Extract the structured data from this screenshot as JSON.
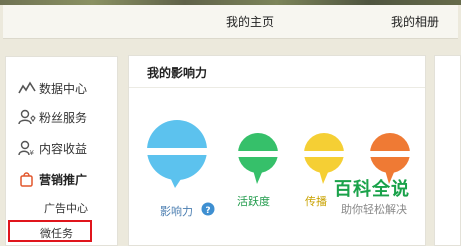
{
  "nav": {
    "tabs": [
      {
        "label": "我的主页"
      },
      {
        "label": "我的相册"
      }
    ]
  },
  "sidebar": {
    "items": [
      {
        "label": "数据中心",
        "icon": "line-chart-icon"
      },
      {
        "label": "粉丝服务",
        "icon": "user-heart-icon"
      },
      {
        "label": "内容收益",
        "icon": "user-yen-icon"
      },
      {
        "label": "营销推广",
        "icon": "shopping-bag-icon"
      }
    ],
    "sub_items": [
      {
        "label": "广告中心"
      },
      {
        "label": "微任务"
      }
    ],
    "highlight_color": "#e0151c"
  },
  "influence": {
    "title": "我的影响力",
    "metrics": [
      {
        "label": "影响力",
        "color": "#5cc2ee",
        "label_color": "#4a7db0"
      },
      {
        "label": "活跃度",
        "color": "#36c06a",
        "label_color": "#1f9a4a"
      },
      {
        "label": "传播",
        "color": "#f5cf34",
        "label_color": "#c9a200"
      },
      {
        "label": "",
        "color": "#ef7a34",
        "label_color": "#d06020"
      }
    ]
  },
  "watermark": {
    "main": "百科全说",
    "sub": "助你轻松解决"
  }
}
